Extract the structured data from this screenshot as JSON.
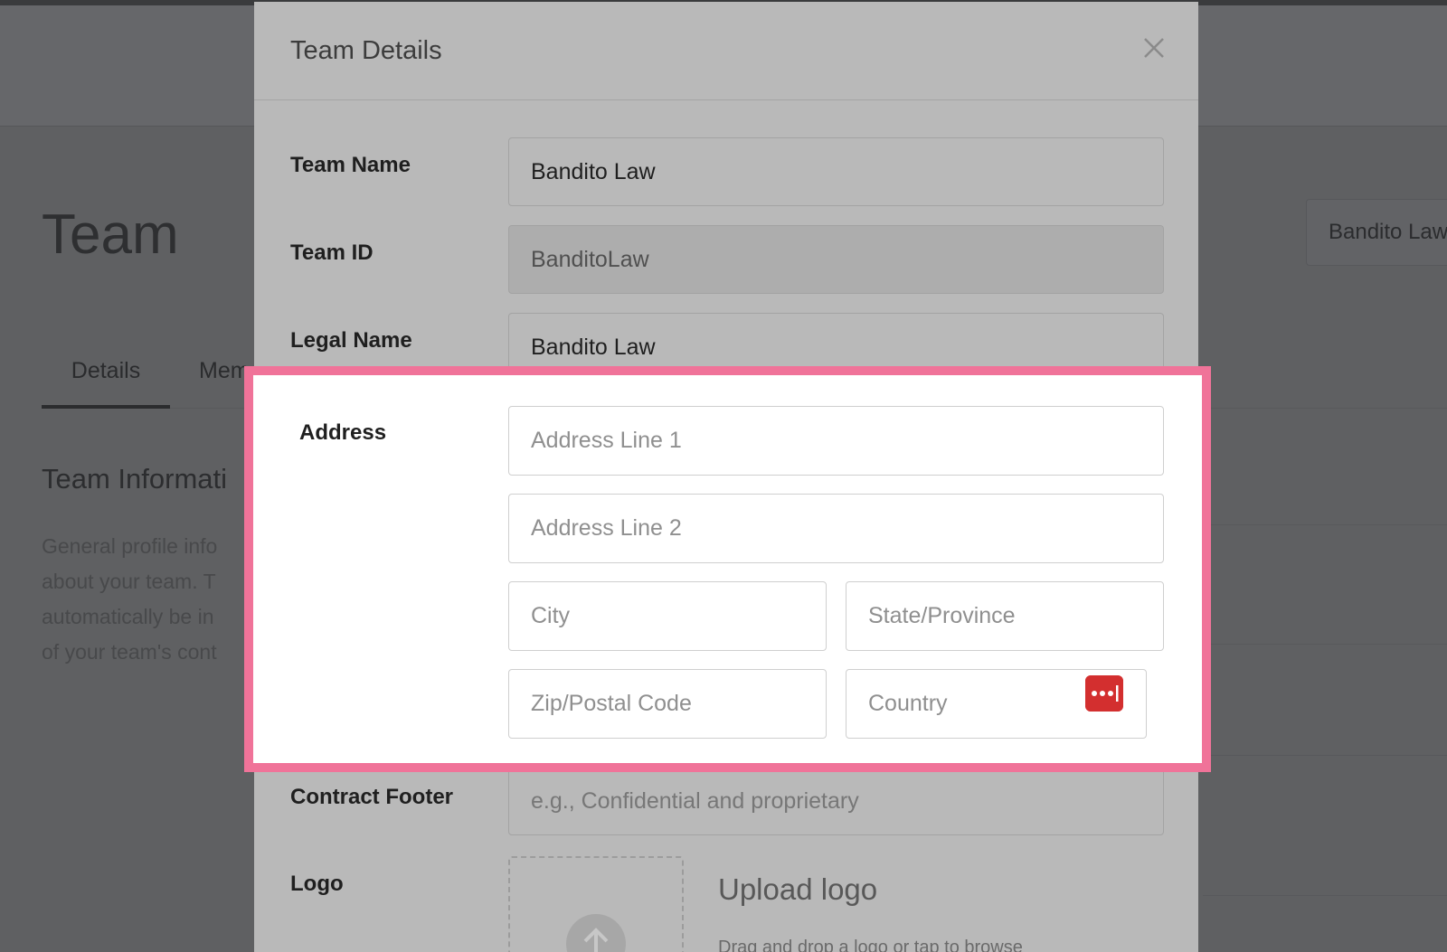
{
  "page": {
    "title": "Team",
    "team_switcher": "Bandito Law",
    "tabs": [
      "Details",
      "Mem"
    ],
    "section_title": "Team Informati",
    "section_desc": [
      "General profile info",
      "about your team. T",
      "automatically be in",
      "of your team's cont"
    ]
  },
  "modal": {
    "title": "Team Details",
    "fields": {
      "team_name": {
        "label": "Team Name",
        "value": "Bandito Law"
      },
      "team_id": {
        "label": "Team ID",
        "value": "BanditoLaw"
      },
      "legal_name": {
        "label": "Legal Name",
        "value": "Bandito Law"
      },
      "address": {
        "label": "Address",
        "line1_placeholder": "Address Line 1",
        "line2_placeholder": "Address Line 2",
        "city_placeholder": "City",
        "state_placeholder": "State/Province",
        "zip_placeholder": "Zip/Postal Code",
        "country_placeholder": "Country"
      },
      "contract_footer": {
        "label": "Contract Footer",
        "placeholder": "e.g., Confidential and proprietary"
      },
      "logo": {
        "label": "Logo",
        "upload_title": "Upload logo",
        "upload_desc": "Drag and drop a logo or tap to browse"
      }
    }
  },
  "colors": {
    "highlight": "#f07399",
    "password_manager": "#d32f2f"
  }
}
